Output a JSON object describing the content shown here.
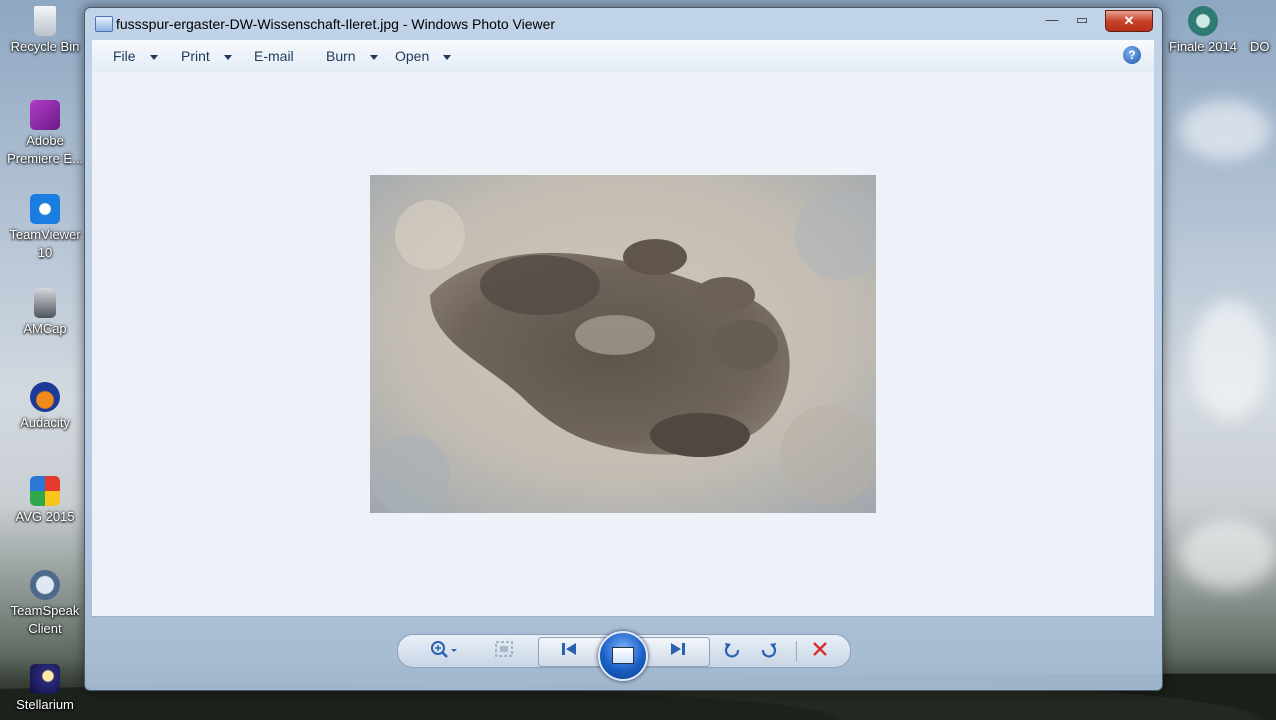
{
  "desktop": {
    "icons_left": [
      {
        "label": "Recycle Bin",
        "icon": "recycle-bin-icon"
      },
      {
        "label": "Adobe Premiere E...",
        "icon": "adobe-premiere-icon"
      },
      {
        "label": "TeamViewer 10",
        "icon": "teamviewer-icon"
      },
      {
        "label": "AMCap",
        "icon": "amcap-icon"
      },
      {
        "label": "Audacity",
        "icon": "audacity-icon"
      },
      {
        "label": "AVG 2015",
        "icon": "avg-icon"
      },
      {
        "label": "TeamSpeak Client",
        "icon": "teamspeak-icon"
      },
      {
        "label": "Stellarium",
        "icon": "stellarium-icon"
      }
    ],
    "icons_right": [
      {
        "label": "Finale 2014",
        "icon": "finale-icon"
      },
      {
        "label": "DO",
        "icon": "generic-icon"
      }
    ]
  },
  "window": {
    "title": "fussspur-ergaster-DW-Wissenschaft-Ileret.jpg - Windows Photo Viewer",
    "buttons": {
      "minimize": "—",
      "maximize": "▭",
      "close": "✕"
    }
  },
  "menubar": {
    "items": [
      {
        "label": "File",
        "has_dropdown": true
      },
      {
        "label": "Print",
        "has_dropdown": true
      },
      {
        "label": "E-mail",
        "has_dropdown": false
      },
      {
        "label": "Burn",
        "has_dropdown": true
      },
      {
        "label": "Open",
        "has_dropdown": true
      }
    ],
    "help": "?"
  },
  "toolbar": {
    "zoom": "zoom-icon",
    "actual_size": "actual-size-icon",
    "previous": "previous-icon",
    "slideshow": "slideshow-icon",
    "next": "next-icon",
    "rotate_ccw": "rotate-counterclockwise-icon",
    "rotate_cw": "rotate-clockwise-icon",
    "delete": "delete-icon"
  },
  "colors": {
    "accent": "#2a61b0",
    "delete": "#d32f2f",
    "viewer_bg": "#eef2f8"
  }
}
